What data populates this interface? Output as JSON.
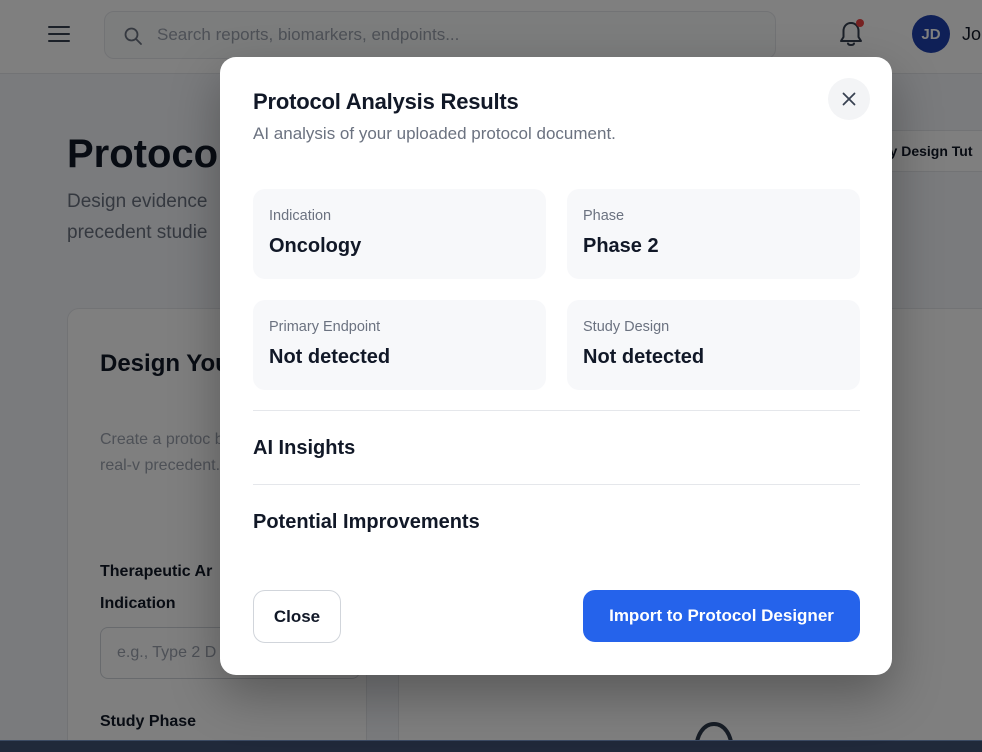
{
  "header": {
    "search_placeholder": "Search reports, biomarkers, endpoints...",
    "user_initials": "JD",
    "user_name": "Jo",
    "has_notification": true
  },
  "page": {
    "title": "Protocol",
    "subtitle": "Design evidence precedent studie",
    "tutorial_button": "dy Design Tut"
  },
  "design_card": {
    "title": "Design You Protocol",
    "description": "Create a protoc based on real-v precedent.",
    "therapeutic_label": "Therapeutic Ar",
    "indication_label": "Indication",
    "indication_placeholder": "e.g., Type 2 D",
    "study_phase_label": "Study Phase"
  },
  "modal": {
    "title": "Protocol Analysis Results",
    "subtitle": "AI analysis of your uploaded protocol document.",
    "cards": [
      {
        "label": "Indication",
        "value": "Oncology"
      },
      {
        "label": "Phase",
        "value": "Phase 2"
      },
      {
        "label": "Primary Endpoint",
        "value": "Not detected"
      },
      {
        "label": "Study Design",
        "value": "Not detected"
      }
    ],
    "sections": [
      "AI Insights",
      "Potential Improvements"
    ],
    "close_button": "Close",
    "import_button": "Import to Protocol Designer"
  },
  "colors": {
    "primary": "#2563eb",
    "notification": "#ef4444",
    "avatar": "#1e40af"
  }
}
